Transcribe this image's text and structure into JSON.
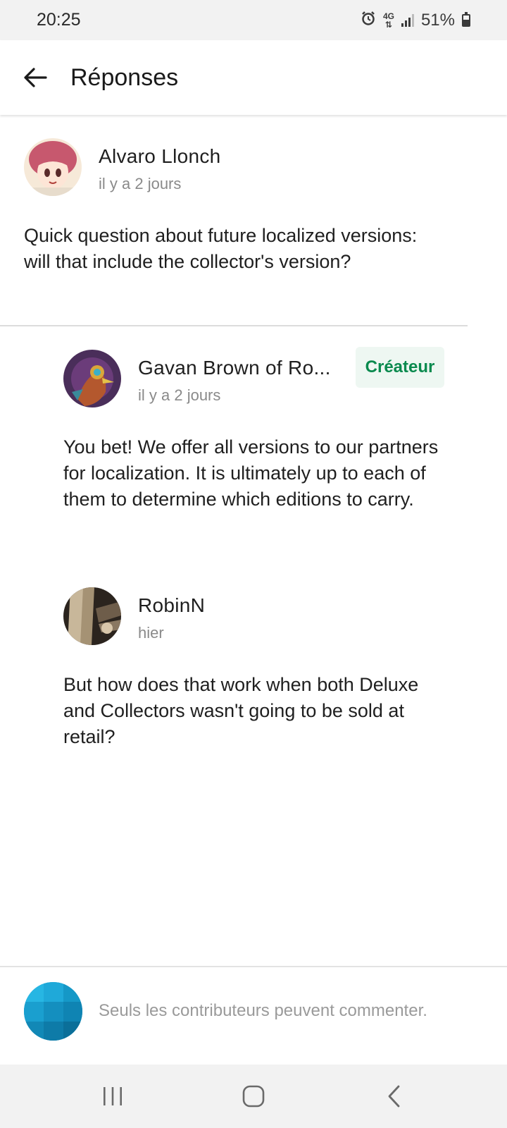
{
  "status_bar": {
    "time": "20:25",
    "network": "4G",
    "battery_percent": "51%",
    "battery_level": 0.51,
    "icons": [
      "alarm-icon",
      "network-4g-icon",
      "signal-icon",
      "battery-icon"
    ]
  },
  "header": {
    "title": "Réponses",
    "back_icon": "arrow-left-icon"
  },
  "parent_comment": {
    "author": "Alvaro Llonch",
    "time": "il y a 2 jours",
    "text": "Quick question about future localized versions: will that include the collector's version?"
  },
  "replies": [
    {
      "author": "Gavan Brown of Ro...",
      "badge": "Créateur",
      "time": "il y a 2 jours",
      "text": "You bet! We offer all versions to our partners for localization. It is ultimately up to each of them to determine which editions to carry."
    },
    {
      "author": "RobinN",
      "time": "hier",
      "text": "But how does that work when both Deluxe and Collectors wasn't going to be sold at retail?"
    }
  ],
  "composer": {
    "placeholder": "Seuls les contributeurs peuvent commenter."
  },
  "navigation": {
    "icons": [
      "recent-apps-icon",
      "home-icon",
      "back-icon"
    ]
  },
  "colors": {
    "accent_green": "#0a8a4e",
    "badge_bg": "#eef7f2",
    "secondary_text": "#8a8a8a"
  }
}
